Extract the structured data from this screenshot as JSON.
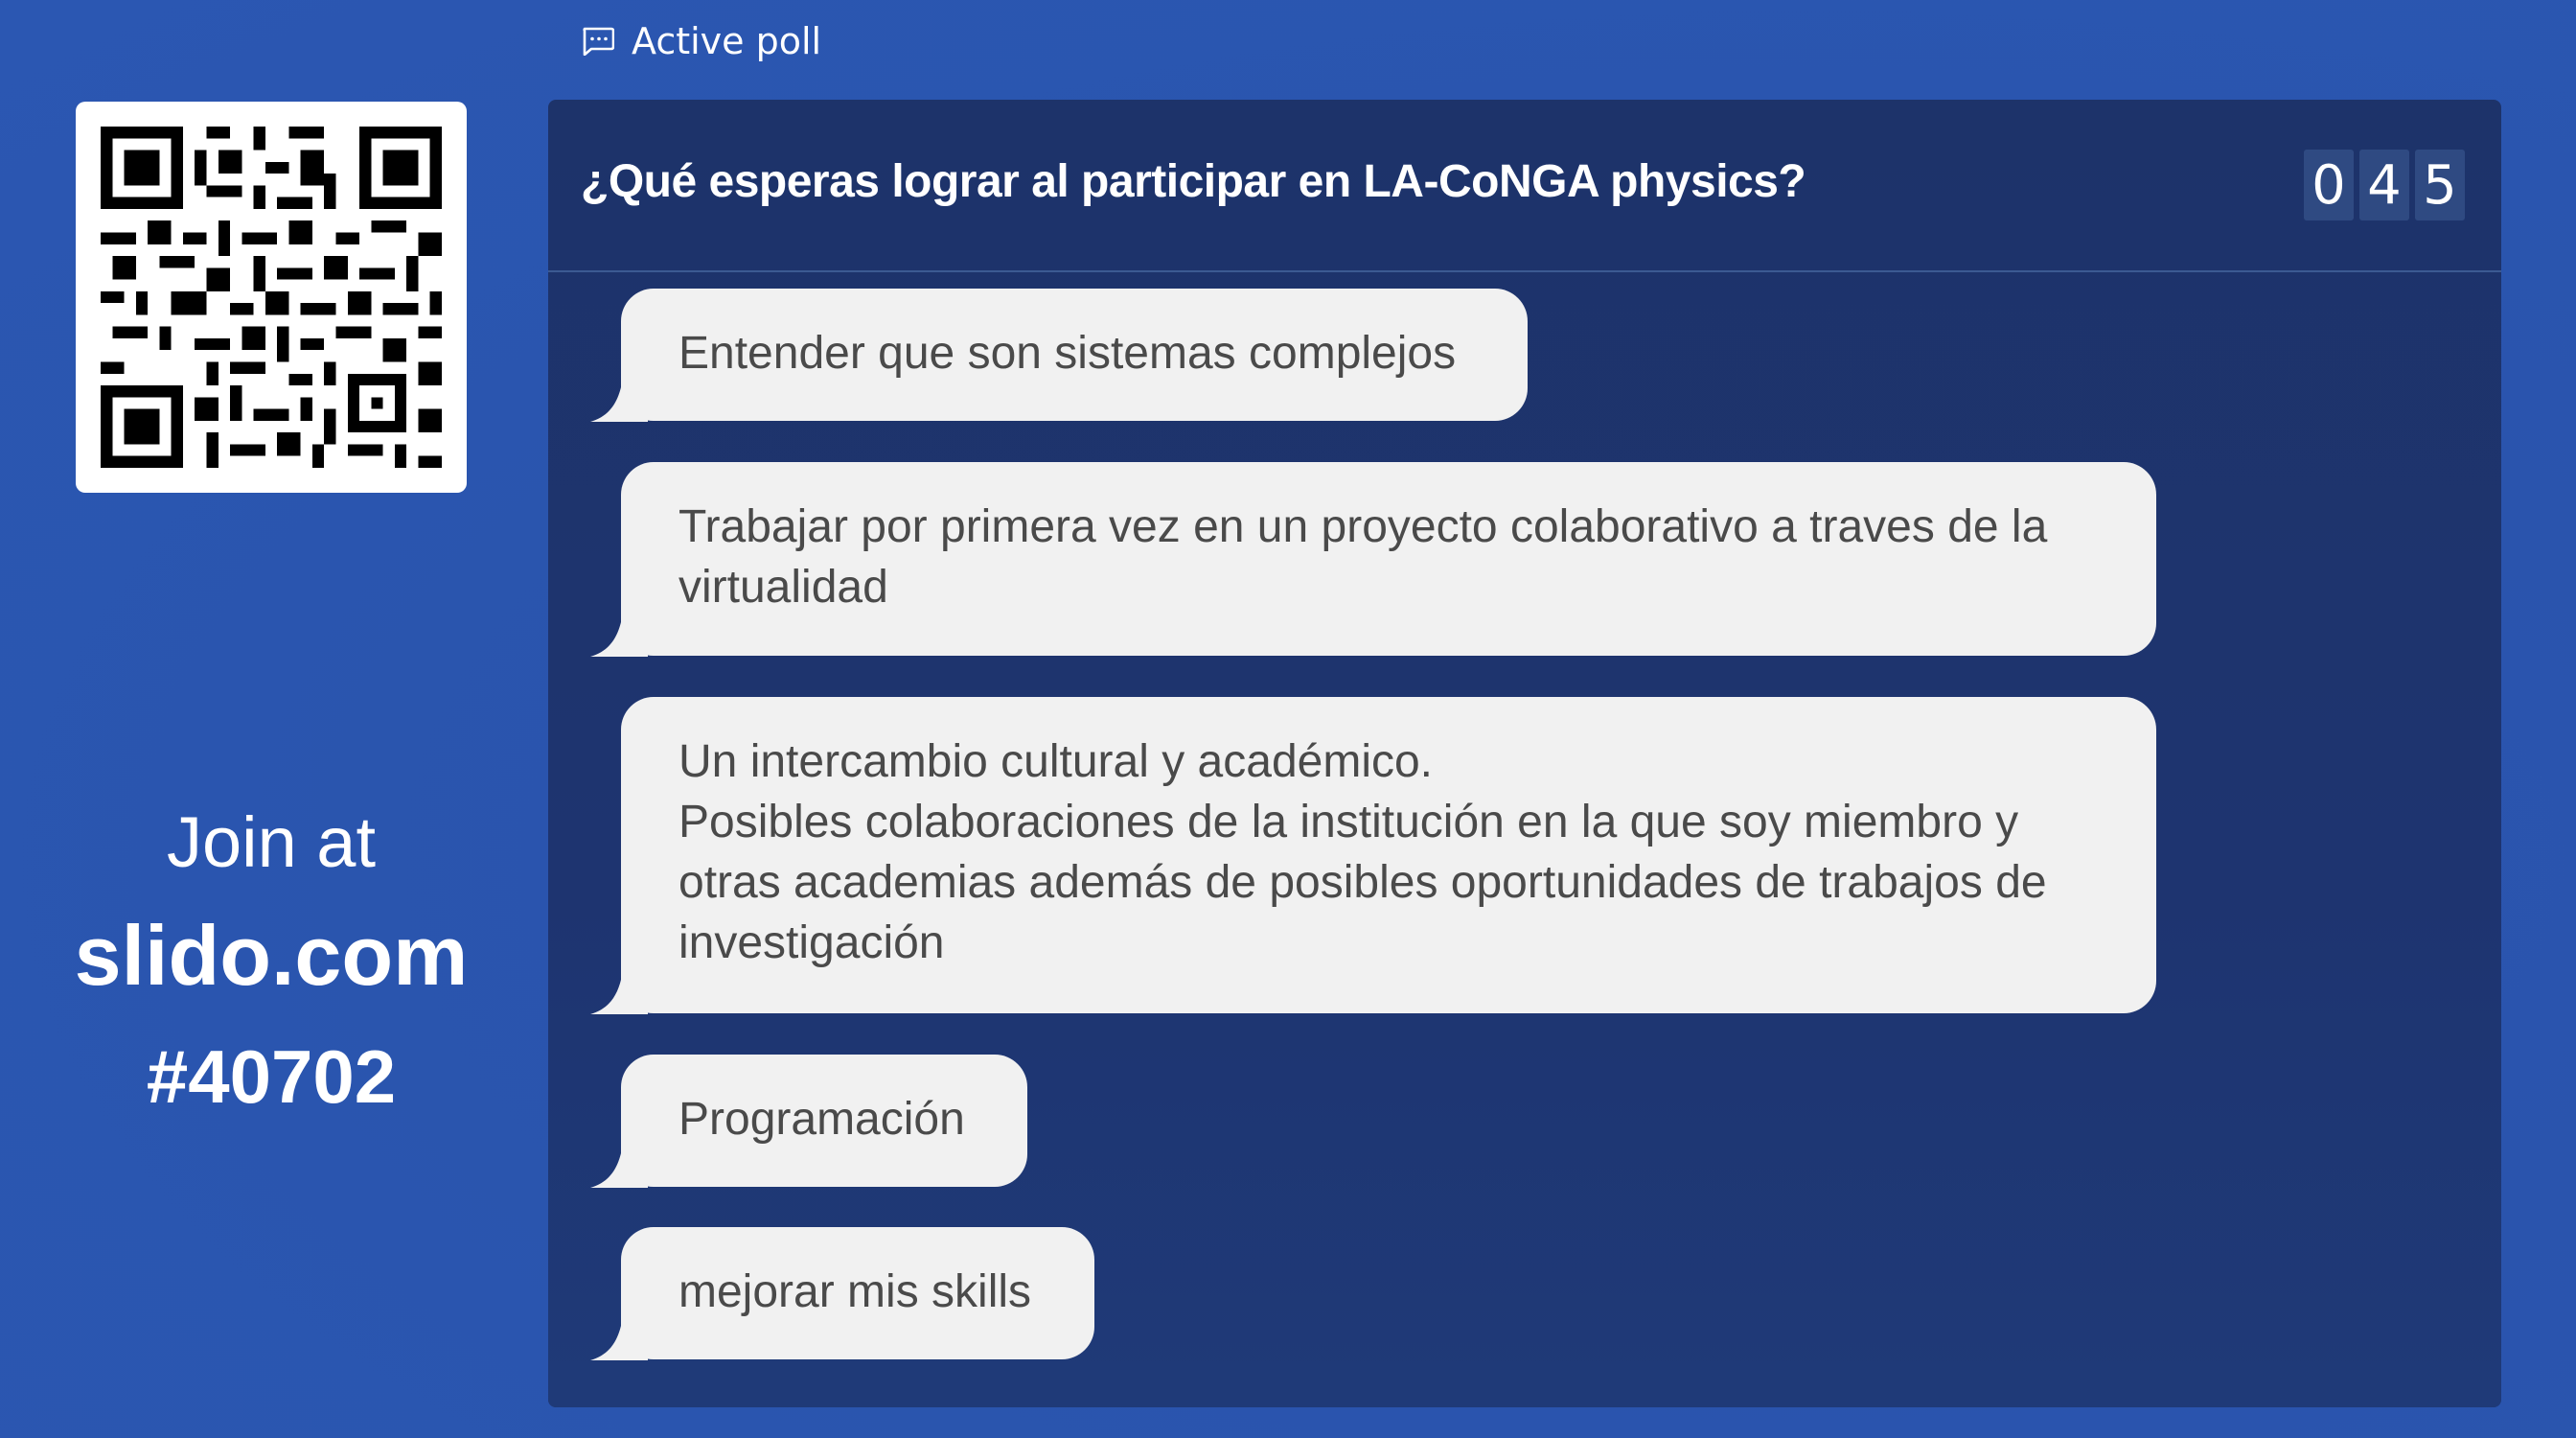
{
  "header": {
    "label": "Active poll",
    "icon": "chat-bubble-icon"
  },
  "join": {
    "line1": "Join at",
    "line2": "slido.com",
    "line3": "#40702"
  },
  "poll": {
    "question": "¿Qué esperas lograr al participar en LA-CoNGA physics?",
    "counter_digits": [
      "0",
      "4",
      "5"
    ],
    "responses": [
      "Entender que son sistemas complejos",
      "Trabajar por primera vez en un proyecto colaborativo a traves de la\nvirtualidad",
      "Un intercambio cultural y académico.\nPosibles colaboraciones de la institución en la que soy miembro y\notras academias además de posibles oportunidades de trabajos de\ninvestigación",
      "Programación",
      "mejorar mis skills"
    ]
  },
  "colors": {
    "background": "#2b56af",
    "panel": "#1e3470",
    "bubble": "#f1f1f1",
    "bubble_text": "#4a4a4a",
    "digit_bg": "#2f4a82"
  }
}
